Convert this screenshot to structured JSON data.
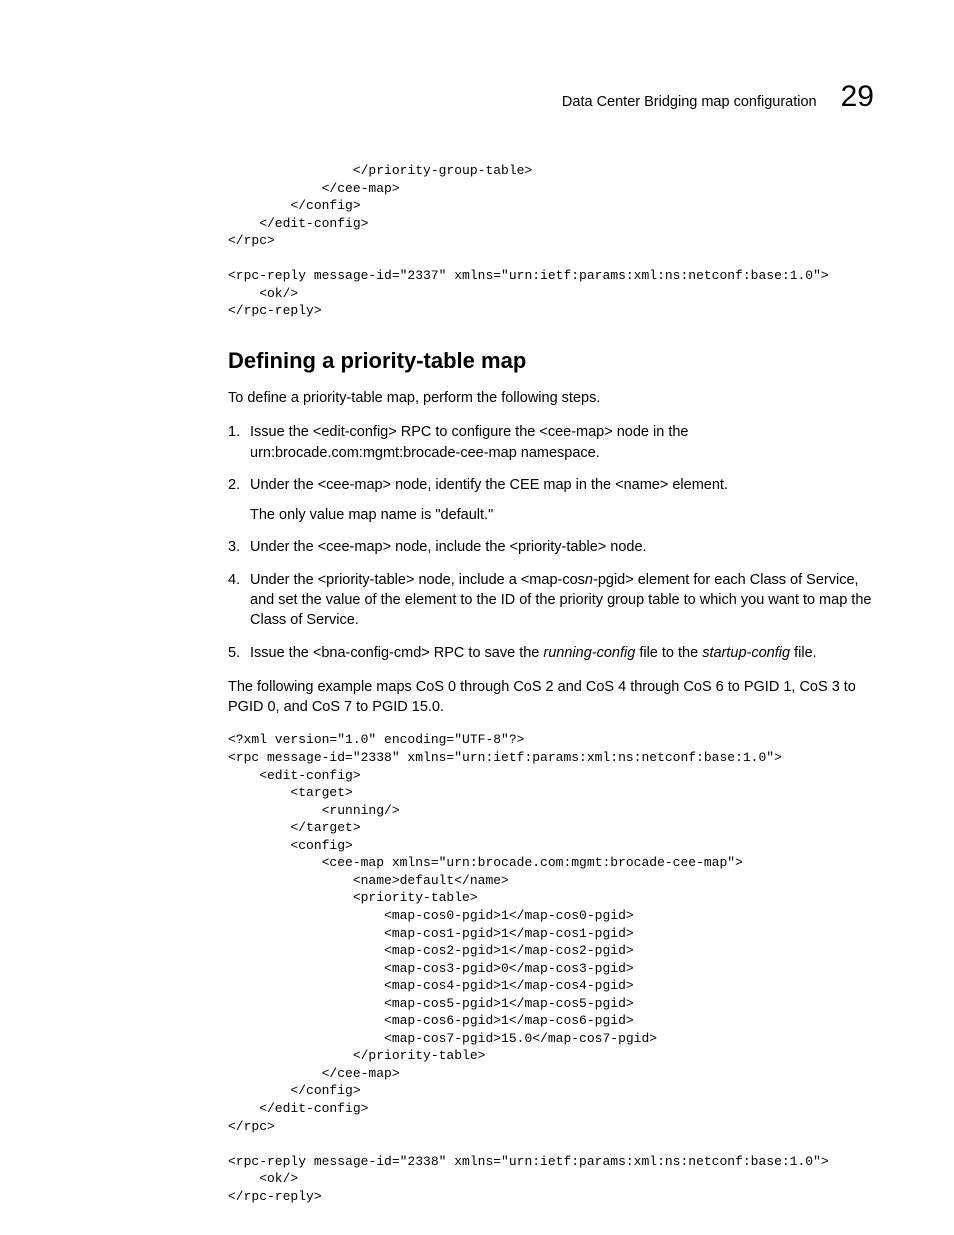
{
  "header": {
    "title": "Data Center Bridging map configuration",
    "number": "29"
  },
  "code1": "                </priority-group-table>\n            </cee-map>\n        </config>\n    </edit-config>\n</rpc>\n\n<rpc-reply message-id=\"2337\" xmlns=\"urn:ietf:params:xml:ns:netconf:base:1.0\">\n    <ok/>\n</rpc-reply>",
  "section": {
    "heading": "Defining a priority-table map",
    "intro": "To define a priority-table map, perform the following steps.",
    "steps": [
      {
        "text_a": "Issue the <edit-config> RPC to configure the <cee-map> node in the urn:brocade.com:mgmt:brocade-cee-map namespace."
      },
      {
        "text_a": "Under the <cee-map> node, identify the CEE map in the <name> element.",
        "sub": "The only value map name is \"default.\""
      },
      {
        "text_a": "Under the <cee-map> node, include the <priority-table> node."
      },
      {
        "text_a": "Under the <priority-table> node, include a <map-cos",
        "ital": "n",
        "text_b": "-pgid> element for each Class of Service, and set the value of the element to the ID of the priority group table to which you want to map the Class of Service."
      },
      {
        "text_a": "Issue the <bna-config-cmd> RPC to save the ",
        "ital": "running-config",
        "text_b": " file to the ",
        "ital2": "startup-config",
        "text_c": " file."
      }
    ],
    "summary": "The following example maps CoS 0 through CoS 2 and CoS 4 through CoS 6 to PGID 1, CoS 3 to PGID 0, and CoS 7 to PGID 15.0."
  },
  "code2": "<?xml version=\"1.0\" encoding=\"UTF-8\"?>\n<rpc message-id=\"2338\" xmlns=\"urn:ietf:params:xml:ns:netconf:base:1.0\">\n    <edit-config>\n        <target>\n            <running/>\n        </target>\n        <config>\n            <cee-map xmlns=\"urn:brocade.com:mgmt:brocade-cee-map\">\n                <name>default</name>\n                <priority-table>\n                    <map-cos0-pgid>1</map-cos0-pgid>\n                    <map-cos1-pgid>1</map-cos1-pgid>\n                    <map-cos2-pgid>1</map-cos2-pgid>\n                    <map-cos3-pgid>0</map-cos3-pgid>\n                    <map-cos4-pgid>1</map-cos4-pgid>\n                    <map-cos5-pgid>1</map-cos5-pgid>\n                    <map-cos6-pgid>1</map-cos6-pgid>\n                    <map-cos7-pgid>15.0</map-cos7-pgid>\n                </priority-table>\n            </cee-map>\n        </config>\n    </edit-config>\n</rpc>\n\n<rpc-reply message-id=\"2338\" xmlns=\"urn:ietf:params:xml:ns:netconf:base:1.0\">\n    <ok/>\n</rpc-reply>"
}
